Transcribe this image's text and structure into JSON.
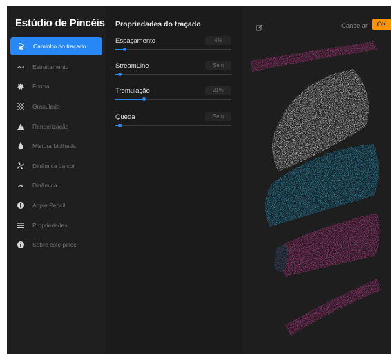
{
  "sidebar": {
    "title": "Estúdio de Pincéis",
    "items": [
      {
        "label": "Caminho do traçado",
        "icon": "stroke-path-icon",
        "active": true
      },
      {
        "label": "Estreitamento",
        "icon": "taper-icon",
        "active": false
      },
      {
        "label": "Forma",
        "icon": "shape-icon",
        "active": false
      },
      {
        "label": "Granulado",
        "icon": "grain-icon",
        "active": false
      },
      {
        "label": "Renderização",
        "icon": "rendering-icon",
        "active": false
      },
      {
        "label": "Mistura Molhada",
        "icon": "wet-mix-icon",
        "active": false
      },
      {
        "label": "Dinâmica da cor",
        "icon": "color-dynamics-icon",
        "active": false
      },
      {
        "label": "Dinâmica",
        "icon": "dynamics-icon",
        "active": false
      },
      {
        "label": "Apple Pencil",
        "icon": "apple-pencil-icon",
        "active": false
      },
      {
        "label": "Propriedades",
        "icon": "properties-icon",
        "active": false
      },
      {
        "label": "Sobre este pincel",
        "icon": "info-icon",
        "active": false
      }
    ]
  },
  "panel": {
    "title": "Propriedades do traçado",
    "settings": [
      {
        "label": "Espaçamento",
        "value": "4%",
        "level": 0.04
      },
      {
        "label": "StreamLine",
        "value": "Sem",
        "level": 0.0
      },
      {
        "label": "Tremulação",
        "value": "21%",
        "level": 0.21
      },
      {
        "label": "Queda",
        "value": "Sem",
        "level": 0.0
      }
    ]
  },
  "preview": {
    "edit_icon": "edit-icon",
    "cancel_label": "Cancelar",
    "ok_label": "OK"
  },
  "colors": {
    "accent": "#2787f5",
    "ok": "#ff9500",
    "magenta": "#d9359b",
    "cyan": "#1aa7d9",
    "white": "#e8e8e8"
  }
}
